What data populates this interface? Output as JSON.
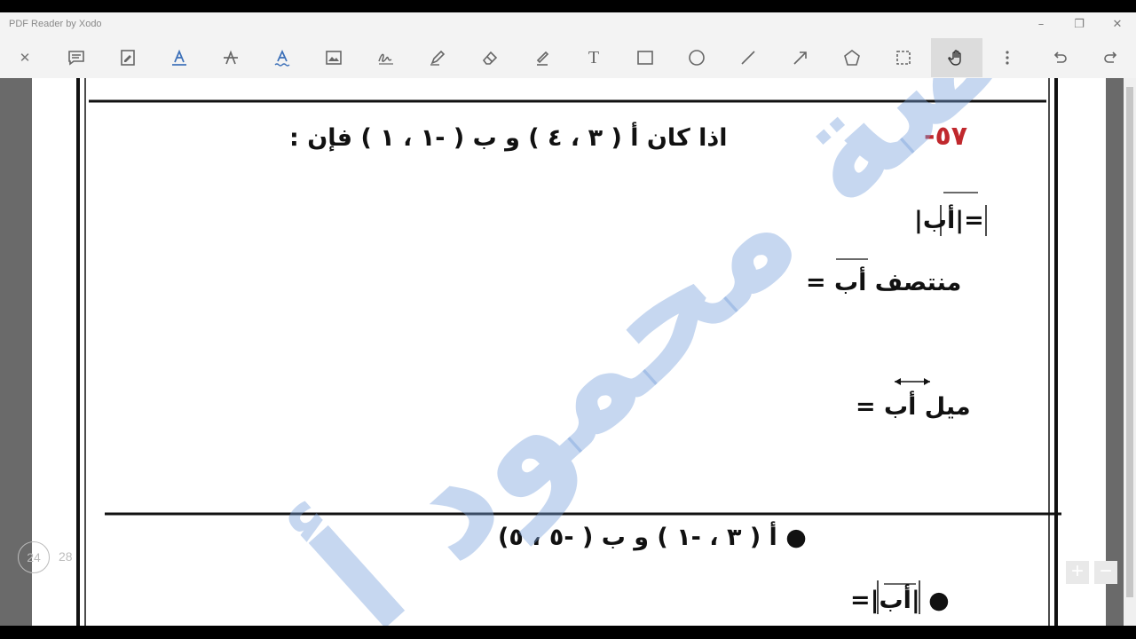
{
  "window": {
    "app_title": "PDF Reader by Xodo",
    "minimize": "–",
    "restore": "❐",
    "close": "✕"
  },
  "toolbar": {
    "close_glyph": "✕",
    "tools": [
      "comment-icon",
      "ink-note-icon",
      "text-underline-icon",
      "strikeout-icon",
      "squiggly-icon",
      "image-icon",
      "signature-icon",
      "pen-icon",
      "eraser-icon",
      "highlighter-icon",
      "free-text-icon",
      "rectangle-icon",
      "ellipse-icon",
      "line-icon",
      "arrow-icon",
      "polygon-icon",
      "area-select-icon",
      "pan-hand-icon",
      "more-icon",
      "undo-icon",
      "redo-icon"
    ],
    "free_text_glyph": "T"
  },
  "document": {
    "problem_number": "٥٧-",
    "problem_text": "اذا كان أ ( ٣ ، ٤ )   و   ب  (   -١  ،  ١ ) فإن :",
    "line_ab_length": "=|أب|",
    "line_midpoint": "منتصف  أب  =",
    "line_slope": "ميل أب  =",
    "bullet_given": "●    أ ( ٣ ، -١ )   و   ب  ( -٥  ،  ٥)",
    "bullet_length": "●  |أب|=",
    "watermark_text": "منصة محمود أ"
  },
  "navigation": {
    "current_page": "24",
    "total_pages": "28",
    "zoom_in": "+",
    "zoom_out": "−"
  }
}
